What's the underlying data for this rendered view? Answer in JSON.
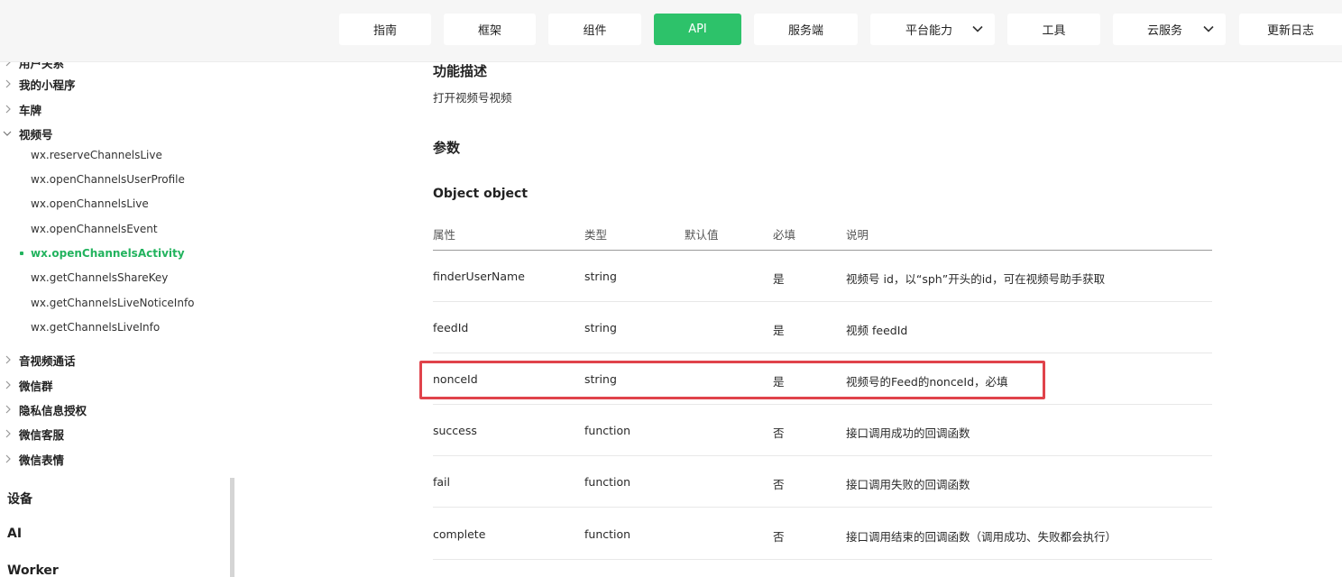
{
  "nav": {
    "items": [
      {
        "label": "指南"
      },
      {
        "label": "框架"
      },
      {
        "label": "组件"
      },
      {
        "label": "API"
      },
      {
        "label": "服务端"
      },
      {
        "label": "平台能力"
      },
      {
        "label": "工具"
      },
      {
        "label": "云服务"
      },
      {
        "label": "更新日志"
      }
    ],
    "active": "API",
    "accent_color": "#2dc26a"
  },
  "sidebar": {
    "partial_top_label": "用户关系",
    "groups": [
      {
        "label": "我的小程序",
        "expanded": false
      },
      {
        "label": "车牌",
        "expanded": false
      },
      {
        "label": "视频号",
        "expanded": true
      }
    ],
    "sub_items": [
      {
        "label": "wx.reserveChannelsLive"
      },
      {
        "label": "wx.openChannelsUserProfile"
      },
      {
        "label": "wx.openChannelsLive"
      },
      {
        "label": "wx.openChannelsEvent"
      },
      {
        "label": "wx.openChannelsActivity",
        "active": true
      },
      {
        "label": "wx.getChannelsShareKey"
      },
      {
        "label": "wx.getChannelsLiveNoticeInfo"
      },
      {
        "label": "wx.getChannelsLiveInfo"
      }
    ],
    "groups_after": [
      {
        "label": "音视频通话"
      },
      {
        "label": "微信群"
      },
      {
        "label": "隐私信息授权"
      },
      {
        "label": "微信客服"
      },
      {
        "label": "微信表情"
      }
    ],
    "categories": [
      {
        "label": "设备"
      },
      {
        "label": "AI"
      },
      {
        "label": "Worker"
      }
    ]
  },
  "main": {
    "func_heading": "功能描述",
    "func_desc": "打开视频号视频",
    "params_heading": "参数",
    "object_heading": "Object object",
    "table": {
      "headers": [
        "属性",
        "类型",
        "默认值",
        "必填",
        "说明"
      ],
      "rows": [
        {
          "name": "finderUserName",
          "type": "string",
          "default": "",
          "required": "是",
          "desc": "视频号 id，以“sph”开头的id，可在视频号助手获取"
        },
        {
          "name": "feedId",
          "type": "string",
          "default": "",
          "required": "是",
          "desc": "视频 feedId"
        },
        {
          "name": "nonceId",
          "type": "string",
          "default": "",
          "required": "是",
          "desc": "视频号的Feed的nonceId，必填",
          "highlighted": true
        },
        {
          "name": "success",
          "type": "function",
          "default": "",
          "required": "否",
          "desc": "接口调用成功的回调函数"
        },
        {
          "name": "fail",
          "type": "function",
          "default": "",
          "required": "否",
          "desc": "接口调用失败的回调函数"
        },
        {
          "name": "complete",
          "type": "function",
          "default": "",
          "required": "否",
          "desc": "接口调用结束的回调函数（调用成功、失败都会执行）"
        }
      ]
    },
    "highlight_color": "#e0434b"
  }
}
